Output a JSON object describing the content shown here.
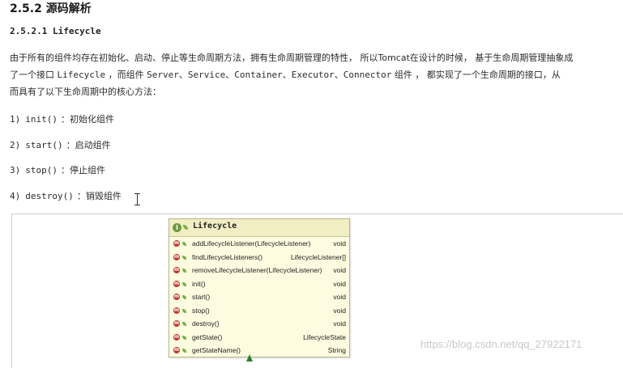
{
  "heading": {
    "section": "2.5.2 源码解析",
    "subsection": "2.5.2.1 Lifecycle"
  },
  "paragraph": {
    "line1": "由于所有的组件均存在初始化、启动、停止等生命周期方法，拥有生命周期管理的特性，  所以Tomcat在设计的时候，  基于生命周期管理抽象成",
    "line2_a": "了一个接口 ",
    "line2_code1": "Lifecycle",
    "line2_b": " ，而组件 ",
    "line2_code2": "Server、Service、Container、Executor、Connector",
    "line2_c": " 组件  ，  都实现了一个生命周期的接口，从",
    "line3": "而具有了以下生命周期中的核心方法："
  },
  "methods": [
    {
      "num": "1)",
      "name": "init()",
      "desc": "：初始化组件"
    },
    {
      "num": "2)",
      "name": "start()",
      "desc": "：启动组件"
    },
    {
      "num": "3)",
      "name": "stop()",
      "desc": "：停止组件"
    },
    {
      "num": "4)",
      "name": "destroy()",
      "desc": "：销毁组件"
    }
  ],
  "uml": {
    "title": "Lifecycle",
    "interface_badge": "I",
    "method_badge": "m",
    "rows": [
      {
        "name": "addLifecycleListener(LifecycleListener)",
        "ret": "void"
      },
      {
        "name": "findLifecycleListeners()",
        "ret": "LifecycleListener[]"
      },
      {
        "name": "removeLifecycleListener(LifecycleListener)",
        "ret": "void"
      },
      {
        "name": "init()",
        "ret": "void"
      },
      {
        "name": "start()",
        "ret": "void"
      },
      {
        "name": "stop()",
        "ret": "void"
      },
      {
        "name": "destroy()",
        "ret": "void"
      },
      {
        "name": "getState()",
        "ret": "LifecycleState"
      },
      {
        "name": "getStateName()",
        "ret": "String"
      }
    ]
  },
  "watermark": "https://blog.csdn.net/qq_27922171",
  "icons": {
    "interface": "interface-icon",
    "method": "method-icon",
    "public": "public-leaf-icon",
    "inheritance_arrow": "inheritance-arrow-icon"
  },
  "colors": {
    "uml_bg": "#fefce0",
    "uml_header": "#f2eec3",
    "method_icon": "#c0392b",
    "interface_icon": "#6a9a3c",
    "arrow": "#2e7d32"
  }
}
